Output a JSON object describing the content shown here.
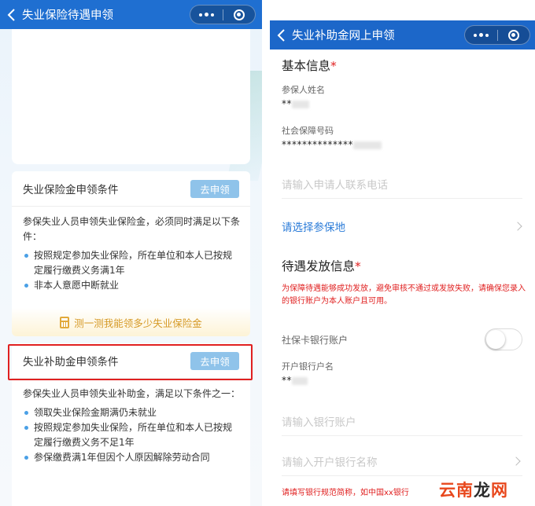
{
  "left": {
    "title": "失业保险待遇申领",
    "card1": {
      "title": "失业保险金申领条件",
      "button": "去申领",
      "intro": "参保失业人员申领失业保险金，必须同时满足以下条件：",
      "items": [
        "按照规定参加失业保险，所在单位和本人已按规定履行缴费义务满1年",
        "非本人意愿中断就业"
      ],
      "calc_link": "测一测我能领多少失业保险金"
    },
    "card2": {
      "title": "失业补助金申领条件",
      "button": "去申领",
      "intro": "参保失业人员申领失业补助金，满足以下条件之一：",
      "items": [
        "领取失业保险金期满仍未就业",
        "按照规定参加失业保险，所在单位和本人已按规定履行缴费义务不足1年",
        "参保缴费满1年但因个人原因解除劳动合同"
      ]
    }
  },
  "right": {
    "title": "失业补助金网上申领",
    "basic_info": {
      "title": "基本信息",
      "required_mark": "*",
      "name_label": "参保人姓名",
      "name_value": "**",
      "ssn_label": "社会保障号码",
      "ssn_value": "**************",
      "phone_placeholder": "请输入申请人联系电话",
      "location_select": "请选择参保地"
    },
    "payment_info": {
      "title": "待遇发放信息",
      "required_mark": "*",
      "notice": "为保障待遇能够成功发放，避免审核不通过或发放失败，请确保您录入的银行账户为本人账户且可用。",
      "ss_card_label": "社保卡银行账户",
      "ss_card_toggle": false,
      "account_name_label": "开户银行户名",
      "account_name_value": "**",
      "account_placeholder": "请输入银行账户",
      "bank_name_placeholder": "请输入开户银行名称",
      "bank_hint": "请填写银行规范简称，如中国xx银行"
    }
  },
  "watermark": {
    "part1": "云南",
    "part2": "龙",
    "part3": "网"
  },
  "colors": {
    "header_blue": "#1f6fd1",
    "button_blue": "#8fc3ea",
    "required_red": "#e02020",
    "link_blue": "#2a7bd8",
    "calc_gold": "#d69a27"
  }
}
